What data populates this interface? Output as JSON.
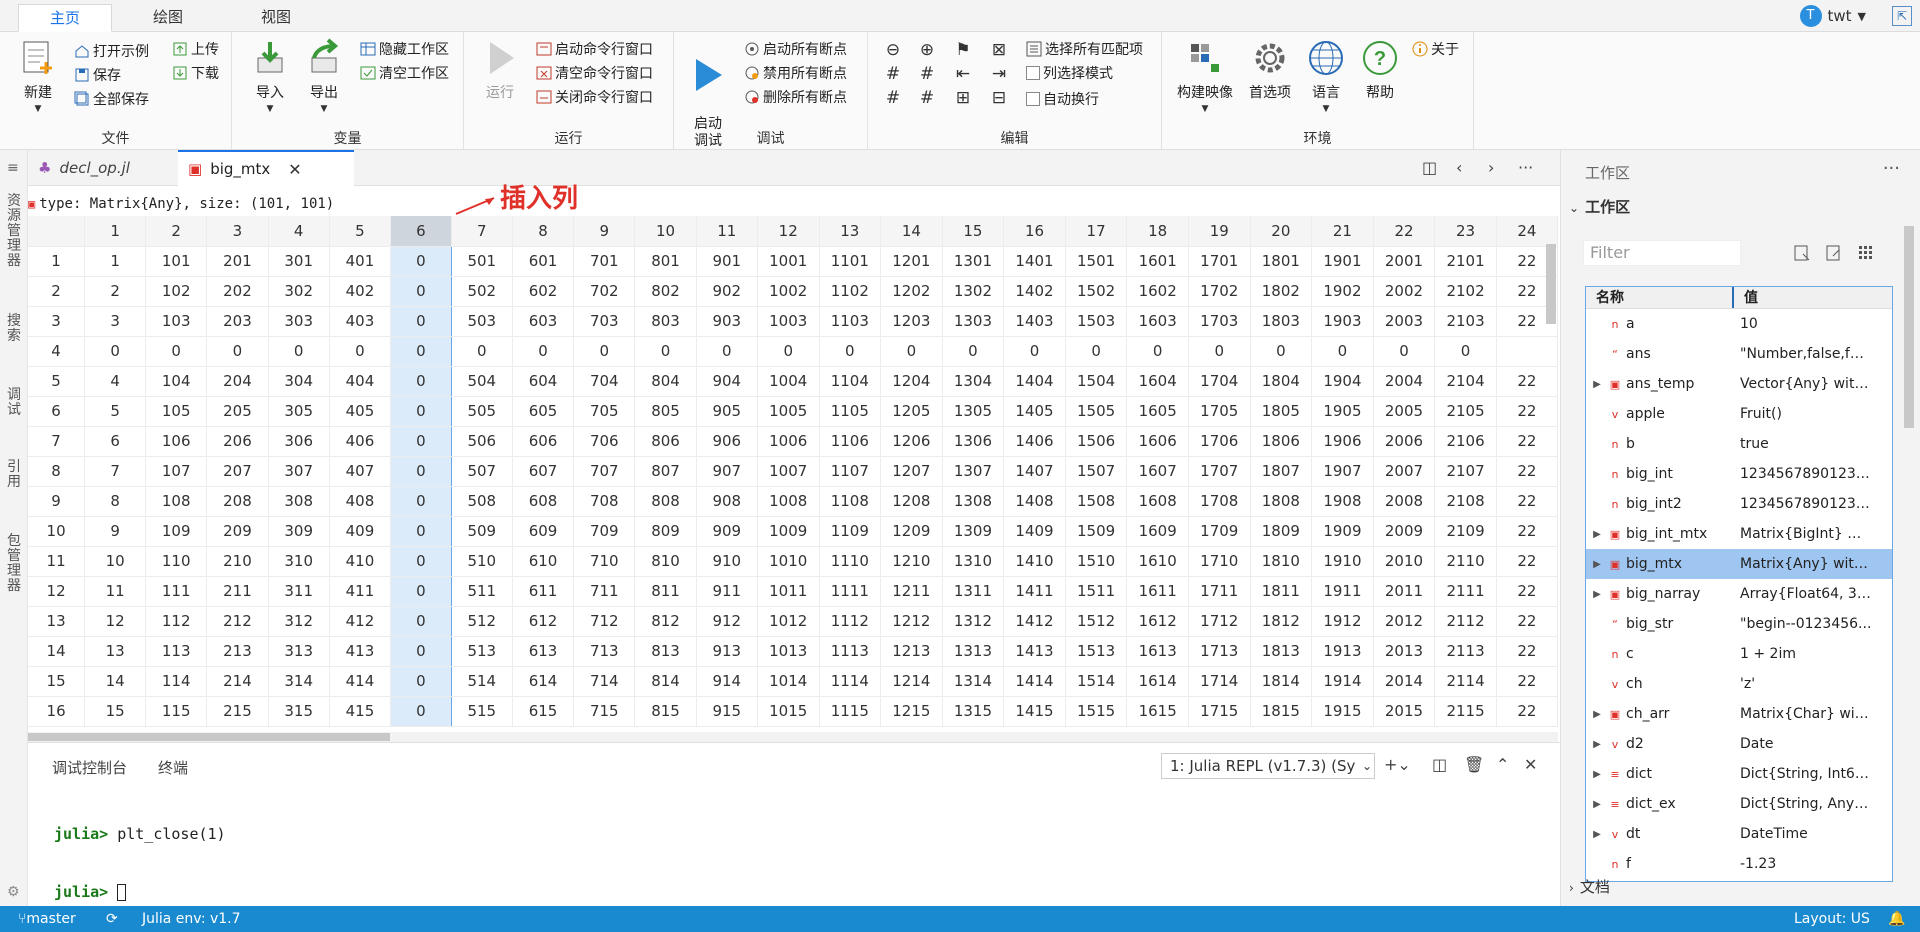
{
  "ribbon_tabs": [
    "主页",
    "绘图",
    "视图"
  ],
  "user": {
    "initial": "T",
    "name": "twt"
  },
  "groups": {
    "file": {
      "label": "文件",
      "new": "新建",
      "open_example": "打开示例",
      "save": "保存",
      "save_all": "全部保存",
      "upload": "上传",
      "download": "下载"
    },
    "vars": {
      "label": "变量",
      "import": "导入",
      "export": "导出",
      "hide_ws": "隐藏工作区",
      "clear_ws": "清空工作区"
    },
    "run": {
      "label": "运行",
      "run": "运行",
      "start_cmd": "启动命令行窗口",
      "clear_cmd": "清空命令行窗口",
      "close_cmd": "关闭命令行窗口"
    },
    "debug": {
      "label": "调试",
      "start_debug": "启动\n调试",
      "start_bp": "启动所有断点",
      "disable_bp": "禁用所有断点",
      "delete_bp": "删除所有断点"
    },
    "edit": {
      "label": "编辑",
      "select_all": "选择所有匹配项",
      "col_select": "列选择模式",
      "word_wrap": "自动换行"
    },
    "env": {
      "label": "环境",
      "build": "构建映像",
      "prefs": "首选项",
      "lang": "语言",
      "help": "帮助"
    },
    "about": "关于"
  },
  "activity": [
    "资源管理器",
    "搜索",
    "调试",
    "引用",
    "包管理器"
  ],
  "editor_tabs": [
    {
      "label": "decl_op.jl",
      "active": false
    },
    {
      "label": "big_mtx",
      "active": true
    }
  ],
  "type_line": "type: Matrix{Any}, size: (101, 101)",
  "annotation": "插入列",
  "matrix": {
    "col_headers": [
      "1",
      "2",
      "3",
      "4",
      "5",
      "6",
      "7",
      "8",
      "9",
      "10",
      "11",
      "12",
      "13",
      "14",
      "15",
      "16",
      "17",
      "18",
      "19",
      "20",
      "21",
      "22",
      "23",
      "24"
    ],
    "selected_col": 5,
    "rows": [
      [
        "1",
        "1",
        "101",
        "201",
        "301",
        "401",
        "0",
        "501",
        "601",
        "701",
        "801",
        "901",
        "1001",
        "1101",
        "1201",
        "1301",
        "1401",
        "1501",
        "1601",
        "1701",
        "1801",
        "1901",
        "2001",
        "2101",
        "22"
      ],
      [
        "2",
        "2",
        "102",
        "202",
        "302",
        "402",
        "0",
        "502",
        "602",
        "702",
        "802",
        "902",
        "1002",
        "1102",
        "1202",
        "1302",
        "1402",
        "1502",
        "1602",
        "1702",
        "1802",
        "1902",
        "2002",
        "2102",
        "22"
      ],
      [
        "3",
        "3",
        "103",
        "203",
        "303",
        "403",
        "0",
        "503",
        "603",
        "703",
        "803",
        "903",
        "1003",
        "1103",
        "1203",
        "1303",
        "1403",
        "1503",
        "1603",
        "1703",
        "1803",
        "1903",
        "2003",
        "2103",
        "22"
      ],
      [
        "4",
        "0",
        "0",
        "0",
        "0",
        "0",
        "0",
        "0",
        "0",
        "0",
        "0",
        "0",
        "0",
        "0",
        "0",
        "0",
        "0",
        "0",
        "0",
        "0",
        "0",
        "0",
        "0",
        "0",
        ""
      ],
      [
        "5",
        "4",
        "104",
        "204",
        "304",
        "404",
        "0",
        "504",
        "604",
        "704",
        "804",
        "904",
        "1004",
        "1104",
        "1204",
        "1304",
        "1404",
        "1504",
        "1604",
        "1704",
        "1804",
        "1904",
        "2004",
        "2104",
        "22"
      ],
      [
        "6",
        "5",
        "105",
        "205",
        "305",
        "405",
        "0",
        "505",
        "605",
        "705",
        "805",
        "905",
        "1005",
        "1105",
        "1205",
        "1305",
        "1405",
        "1505",
        "1605",
        "1705",
        "1805",
        "1905",
        "2005",
        "2105",
        "22"
      ],
      [
        "7",
        "6",
        "106",
        "206",
        "306",
        "406",
        "0",
        "506",
        "606",
        "706",
        "806",
        "906",
        "1006",
        "1106",
        "1206",
        "1306",
        "1406",
        "1506",
        "1606",
        "1706",
        "1806",
        "1906",
        "2006",
        "2106",
        "22"
      ],
      [
        "8",
        "7",
        "107",
        "207",
        "307",
        "407",
        "0",
        "507",
        "607",
        "707",
        "807",
        "907",
        "1007",
        "1107",
        "1207",
        "1307",
        "1407",
        "1507",
        "1607",
        "1707",
        "1807",
        "1907",
        "2007",
        "2107",
        "22"
      ],
      [
        "9",
        "8",
        "108",
        "208",
        "308",
        "408",
        "0",
        "508",
        "608",
        "708",
        "808",
        "908",
        "1008",
        "1108",
        "1208",
        "1308",
        "1408",
        "1508",
        "1608",
        "1708",
        "1808",
        "1908",
        "2008",
        "2108",
        "22"
      ],
      [
        "10",
        "9",
        "109",
        "209",
        "309",
        "409",
        "0",
        "509",
        "609",
        "709",
        "809",
        "909",
        "1009",
        "1109",
        "1209",
        "1309",
        "1409",
        "1509",
        "1609",
        "1709",
        "1809",
        "1909",
        "2009",
        "2109",
        "22"
      ],
      [
        "11",
        "10",
        "110",
        "210",
        "310",
        "410",
        "0",
        "510",
        "610",
        "710",
        "810",
        "910",
        "1010",
        "1110",
        "1210",
        "1310",
        "1410",
        "1510",
        "1610",
        "1710",
        "1810",
        "1910",
        "2010",
        "2110",
        "22"
      ],
      [
        "12",
        "11",
        "111",
        "211",
        "311",
        "411",
        "0",
        "511",
        "611",
        "711",
        "811",
        "911",
        "1011",
        "1111",
        "1211",
        "1311",
        "1411",
        "1511",
        "1611",
        "1711",
        "1811",
        "1911",
        "2011",
        "2111",
        "22"
      ],
      [
        "13",
        "12",
        "112",
        "212",
        "312",
        "412",
        "0",
        "512",
        "612",
        "712",
        "812",
        "912",
        "1012",
        "1112",
        "1212",
        "1312",
        "1412",
        "1512",
        "1612",
        "1712",
        "1812",
        "1912",
        "2012",
        "2112",
        "22"
      ],
      [
        "14",
        "13",
        "113",
        "213",
        "313",
        "413",
        "0",
        "513",
        "613",
        "713",
        "813",
        "913",
        "1013",
        "1113",
        "1213",
        "1313",
        "1413",
        "1513",
        "1613",
        "1713",
        "1813",
        "1913",
        "2013",
        "2113",
        "22"
      ],
      [
        "15",
        "14",
        "114",
        "214",
        "314",
        "414",
        "0",
        "514",
        "614",
        "714",
        "814",
        "914",
        "1014",
        "1114",
        "1214",
        "1314",
        "1414",
        "1514",
        "1614",
        "1714",
        "1814",
        "1914",
        "2014",
        "2114",
        "22"
      ],
      [
        "16",
        "15",
        "115",
        "215",
        "315",
        "415",
        "0",
        "515",
        "615",
        "715",
        "815",
        "915",
        "1015",
        "1115",
        "1215",
        "1315",
        "1415",
        "1515",
        "1615",
        "1715",
        "1815",
        "1915",
        "2015",
        "2115",
        "22"
      ]
    ]
  },
  "panel": {
    "tabs": [
      "调试控制台",
      "终端"
    ],
    "repl_select": "1: Julia REPL (v1.7.3) (Sy",
    "lines": [
      {
        "prompt": "julia>",
        "cmd": " plt_close(1)"
      },
      {
        "prompt": "julia>",
        "cmd": " "
      }
    ]
  },
  "workspace": {
    "title": "工作区",
    "section": "工作区",
    "filter_placeholder": "Filter",
    "col_name": "名称",
    "col_value": "值",
    "rows": [
      {
        "exp": "",
        "type": "n",
        "name": "a",
        "value": "10",
        "sel": false
      },
      {
        "exp": "",
        "type": "“",
        "name": "ans",
        "value": "\"Number,false,fal...",
        "sel": false
      },
      {
        "exp": "▶",
        "type": "▣",
        "name": "ans_temp",
        "value": "Vector{Any} with ...",
        "sel": false
      },
      {
        "exp": "",
        "type": "v",
        "name": "apple",
        "value": "Fruit()",
        "sel": false
      },
      {
        "exp": "",
        "type": "n",
        "name": "b",
        "value": "true",
        "sel": false
      },
      {
        "exp": "",
        "type": "n",
        "name": "big_int",
        "value": "12345678901234...",
        "sel": false
      },
      {
        "exp": "",
        "type": "n",
        "name": "big_int2",
        "value": "12345678901234...",
        "sel": false
      },
      {
        "exp": "▶",
        "type": "▣",
        "name": "big_int_mtx",
        "value": "Matrix{BigInt} wit...",
        "sel": false
      },
      {
        "exp": "▶",
        "type": "▣",
        "name": "big_mtx",
        "value": "Matrix{Any} with ...",
        "sel": true
      },
      {
        "exp": "▶",
        "type": "▣",
        "name": "big_narray",
        "value": "Array{Float64, 3} ...",
        "sel": false
      },
      {
        "exp": "",
        "type": "“",
        "name": "big_str",
        "value": "\"begin--0123456...",
        "sel": false
      },
      {
        "exp": "",
        "type": "n",
        "name": "c",
        "value": "1 + 2im",
        "sel": false
      },
      {
        "exp": "",
        "type": "v",
        "name": "ch",
        "value": "'z'",
        "sel": false
      },
      {
        "exp": "▶",
        "type": "▣",
        "name": "ch_arr",
        "value": "Matrix{Char} with...",
        "sel": false
      },
      {
        "exp": "▶",
        "type": "v",
        "name": "d2",
        "value": "Date",
        "sel": false
      },
      {
        "exp": "▶",
        "type": "≡",
        "name": "dict",
        "value": "Dict{String, Int64...",
        "sel": false
      },
      {
        "exp": "▶",
        "type": "≡",
        "name": "dict_ex",
        "value": "Dict{String, Any} ...",
        "sel": false
      },
      {
        "exp": "▶",
        "type": "v",
        "name": "dt",
        "value": "DateTime",
        "sel": false
      },
      {
        "exp": "",
        "type": "n",
        "name": "f",
        "value": "-1.23",
        "sel": false
      }
    ],
    "docs": "文档"
  },
  "status": {
    "branch": "master",
    "env": "Julia env: v1.7",
    "layout": "Layout: US"
  },
  "colors": {
    "accent": "#1a73e8",
    "status_bar": "#1a8ad0",
    "annotation": "#e0302a",
    "selected_col": "#dcebfa",
    "selected_row": "#9fc6f0"
  }
}
